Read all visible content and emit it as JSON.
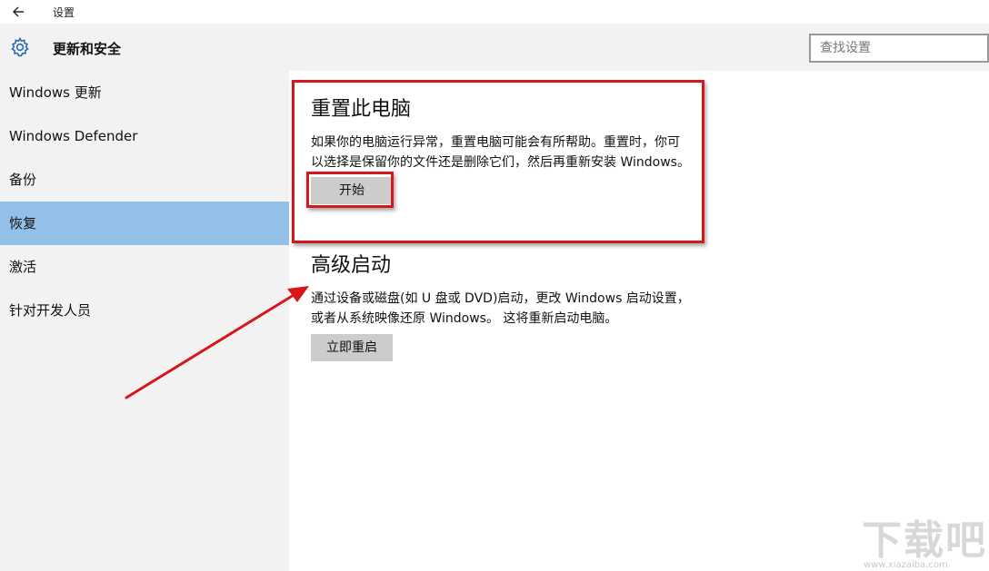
{
  "titlebar": {
    "app_title": "设置"
  },
  "header": {
    "title": "更新和安全"
  },
  "search": {
    "placeholder": "查找设置"
  },
  "sidebar": {
    "items": [
      {
        "label": "Windows 更新"
      },
      {
        "label": "Windows Defender"
      },
      {
        "label": "备份"
      },
      {
        "label": "恢复",
        "active": true
      },
      {
        "label": "激活"
      },
      {
        "label": "针对开发人员"
      }
    ]
  },
  "reset": {
    "title": "重置此电脑",
    "desc_line1": "如果你的电脑运行异常，重置电脑可能会有所帮助。重置时，你可",
    "desc_line2": "以选择是保留你的文件还是删除它们，然后再重新安装 Windows。",
    "button": "开始"
  },
  "advanced": {
    "title": "高级启动",
    "desc_line1": "通过设备或磁盘(如 U 盘或 DVD)启动，更改 Windows 启动设置，",
    "desc_line2": "或者从系统映像还原 Windows。 这将重新启动电脑。",
    "button": "立即重启"
  },
  "watermark": {
    "text": "下载吧",
    "sub": "www.xiazaiba.com"
  },
  "colors": {
    "active_nav": "#93c0e6",
    "annotation_red": "#d6161b",
    "button_gray": "#cccccc"
  }
}
